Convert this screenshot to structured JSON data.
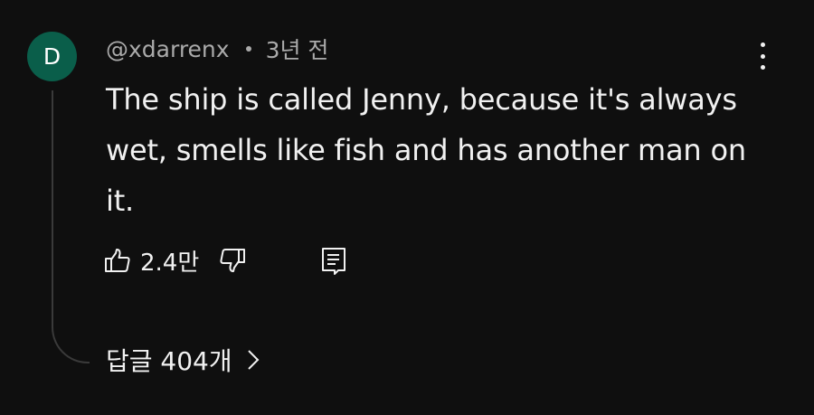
{
  "comment": {
    "avatar_letter": "D",
    "avatar_color": "#0a5e4a",
    "username": "@xdarrenx",
    "time": "3년 전",
    "text": "The ship is called Jenny, because it's always wet, smells like fish and has another man on it.",
    "likes": "2.4만",
    "replies_label": "답글 404개"
  },
  "icons": {
    "like": "thumbs-up-icon",
    "dislike": "thumbs-down-icon",
    "reply": "reply-comment-icon",
    "more": "more-vertical-icon",
    "chevron": "chevron-right-icon"
  }
}
